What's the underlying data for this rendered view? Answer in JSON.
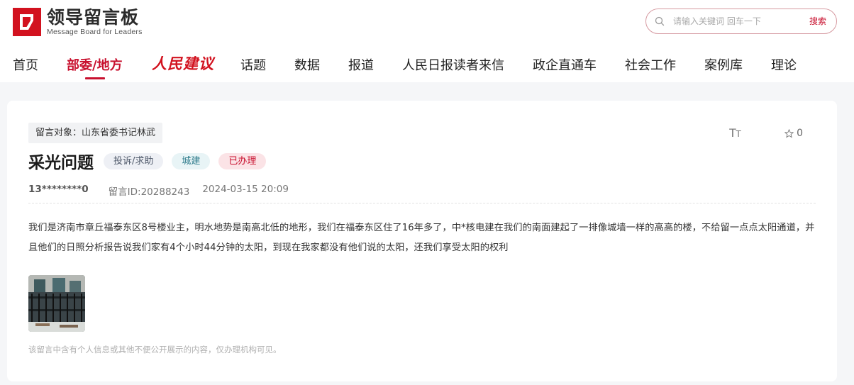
{
  "header": {
    "logo_title": "领导留言板",
    "logo_subtitle": "Message Board for Leaders",
    "brand_color": "#c8102e",
    "search": {
      "placeholder": "请输入关键词 回车一下",
      "button_label": "搜索"
    }
  },
  "nav": {
    "items": [
      {
        "label": "首页"
      },
      {
        "label": "部委/地方",
        "active": true
      },
      {
        "label": "人民建议"
      },
      {
        "label": "话题"
      },
      {
        "label": "数据"
      },
      {
        "label": "报道"
      },
      {
        "label": "人民日报读者来信"
      },
      {
        "label": "政企直通车"
      },
      {
        "label": "社会工作"
      },
      {
        "label": "案例库"
      },
      {
        "label": "理论"
      }
    ]
  },
  "message": {
    "target": "留言对象：山东省委书记林武",
    "title": "采光问题",
    "tags": [
      "投诉/求助",
      "城建",
      "已办理"
    ],
    "user": "13********0",
    "message_id": "留言ID:20288243",
    "time": "2024-03-15 20:09",
    "font_icon_label": "TT",
    "favorite_count": "0",
    "content": "我们是济南市章丘福泰东区8号楼业主，明水地势是南高北低的地形，我们在福泰东区住了16年多了，中*核电建在我们的南面建起了一排像城墙一样的高高的楼，不给留一点点太阳通道，并且他们的日照分析报告说我们家有4个小时44分钟的太阳，到现在我家都没有他们说的太阳，还我们享受太阳的权利",
    "notice": "该留言中含有个人信息或其他不便公开展示的内容，仅办理机构可见。"
  }
}
